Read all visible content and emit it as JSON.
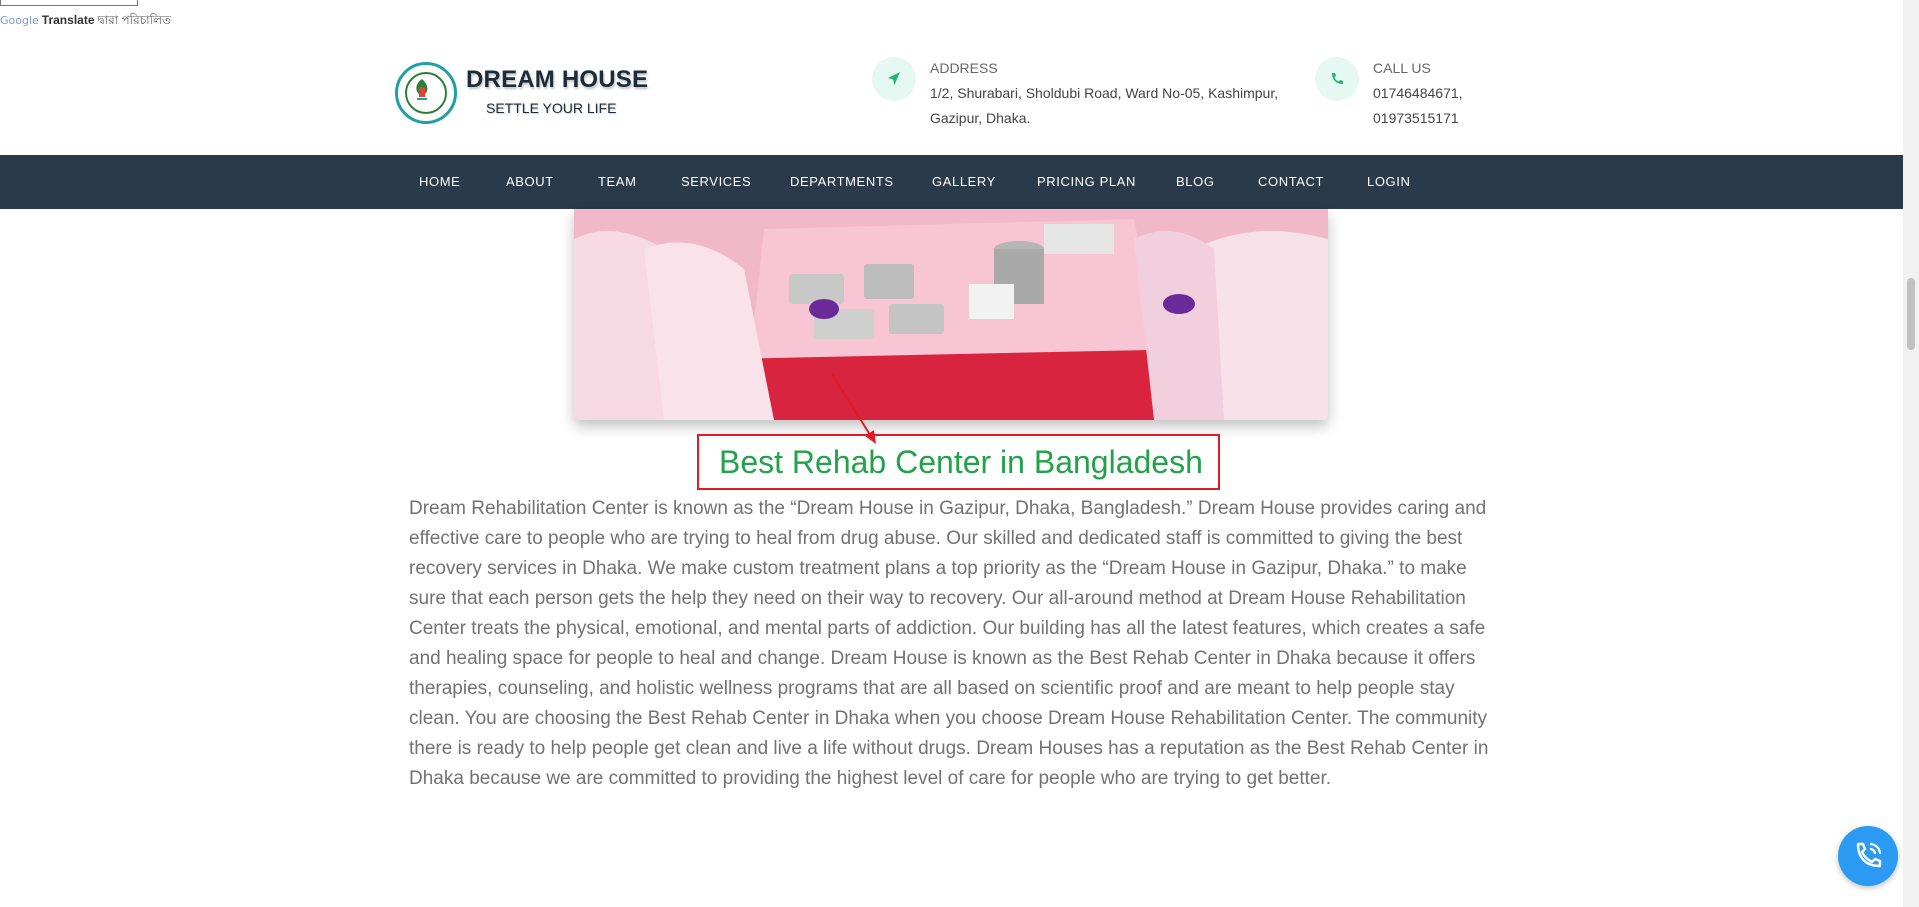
{
  "translate_bar": {
    "google": "Google",
    "translate": "Translate",
    "suffix": "দ্বারা পরিচালিত"
  },
  "brand": {
    "name": "DREAM HOUSE",
    "tagline": "SETTLE YOUR LIFE",
    "logo_text": "Dream House",
    "logo_subtext": "Settle Your Life"
  },
  "address": {
    "icon": "location-arrow-icon",
    "label": "ADDRESS",
    "line1": "1/2, Shurabari, Sholdubi Road, Ward No-05, Kashimpur,",
    "line2": "Gazipur, Dhaka."
  },
  "call": {
    "icon": "phone-icon",
    "label": "CALL US",
    "line1": "01746484671,",
    "line2": "01973515171"
  },
  "nav": {
    "items": [
      "HOME",
      "ABOUT",
      "TEAM",
      "SERVICES",
      "DEPARTMENTS",
      "GALLERY",
      "PRICING PLAN",
      "BLOG",
      "CONTACT",
      "LOGIN"
    ]
  },
  "content": {
    "heading": "Best Rehab Center in Bangladesh",
    "paragraph": "Dream Rehabilitation Center is known as the “Dream House in Gazipur, Dhaka, Bangladesh.” Dream House provides caring and effective care to people who are trying to heal from drug abuse. Our skilled and dedicated staff is committed to giving the best recovery services in Dhaka. We make custom treatment plans a top priority as the “Dream House in Gazipur, Dhaka.” to make sure that each person gets the help they need on their way to recovery. Our all-around method at Dream House Rehabilitation Center treats the physical, emotional, and mental parts of addiction. Our building has all the latest features, which creates a safe and healing space for people to heal and change. Dream House is known as the Best Rehab Center in Dhaka because it offers therapies, counseling, and holistic wellness programs that are all based on scientific proof and are meant to help people stay clean. You are choosing the Best Rehab Center in Dhaka when you choose Dream House Rehabilitation Center. The community there is ready to help people get clean and live a life without drugs. Dream Houses has a reputation as the Best Rehab Center in Dhaka because we are committed to providing the highest level of care for people who are trying to get better."
  },
  "colors": {
    "nav_bg": "#2b3a4a",
    "heading_green": "#22a34a",
    "annotation_red": "#e01b24",
    "fab_blue": "#2b9af3"
  },
  "fab": {
    "icon": "phone-call-icon"
  }
}
